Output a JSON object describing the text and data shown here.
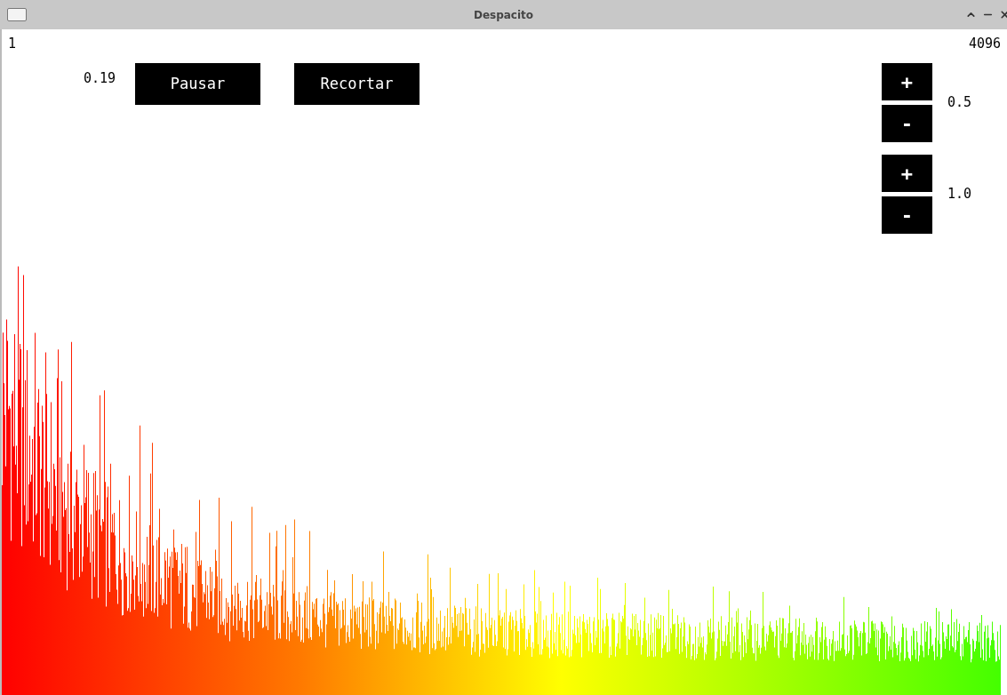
{
  "window": {
    "title": "Despacito"
  },
  "range": {
    "start": "1",
    "end": "4096"
  },
  "speed": "0.19",
  "buttons": [
    "Pausar",
    "Recortar"
  ],
  "steppers": [
    {
      "plus": "+",
      "minus": "-",
      "value": "0.5"
    },
    {
      "plus": "+",
      "minus": "-",
      "value": "1.0"
    }
  ]
}
